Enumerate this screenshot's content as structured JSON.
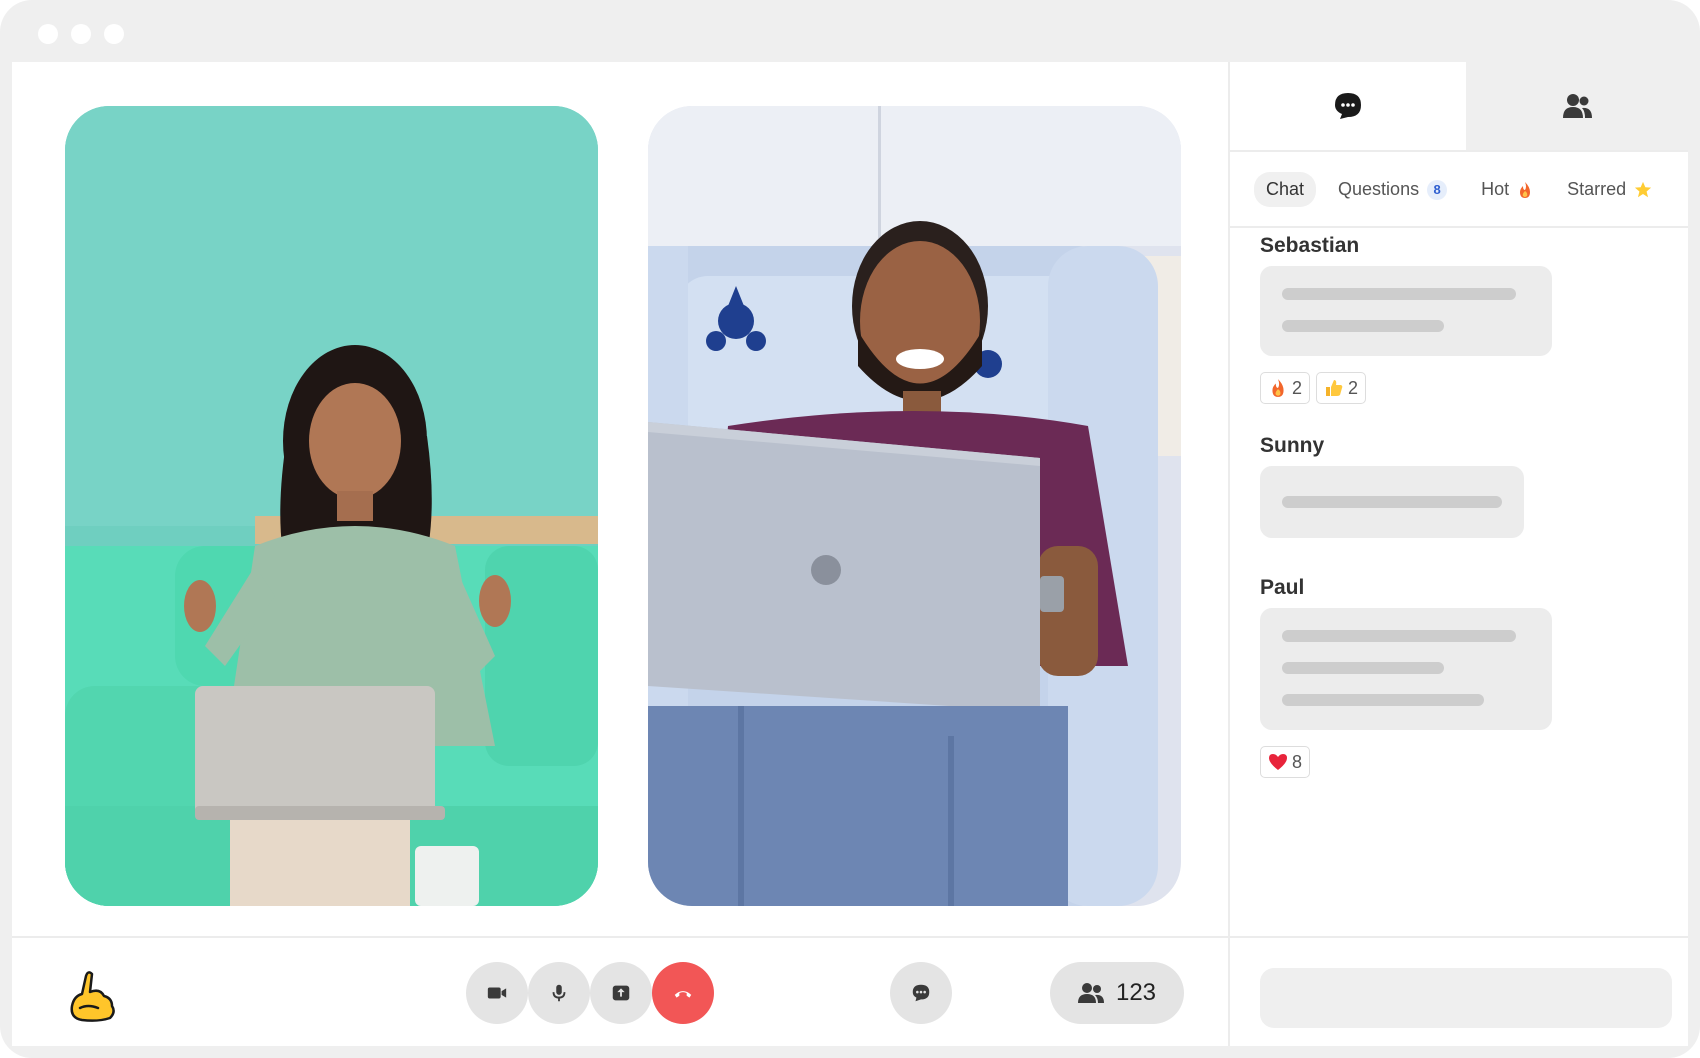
{
  "colors": {
    "window_bg": "#efefef",
    "end_call": "#f25656",
    "control_bg": "#e4e4e4",
    "bubble_bg": "#ececec",
    "badge_text": "#2f5fd0"
  },
  "window": {
    "controls": [
      "dot",
      "dot",
      "dot"
    ]
  },
  "videos": [
    {
      "participant": "woman-with-laptop-on-teal-sofa"
    },
    {
      "participant": "man-with-laptop-in-armchair"
    }
  ],
  "toolbar": {
    "logo_icon": "hand-logo-icon",
    "buttons": [
      "camera-icon",
      "microphone-icon",
      "share-screen-icon",
      "end-call-icon",
      "chat-icon"
    ],
    "participants_count": "123"
  },
  "panel": {
    "top_tabs": [
      "chat-bubble-icon",
      "people-icon"
    ],
    "subtabs": {
      "chat": "Chat",
      "questions": "Questions",
      "questions_count": "8",
      "hot": "Hot",
      "hot_icon": "fire-icon",
      "starred": "Starred",
      "starred_icon": "star-icon"
    },
    "messages": [
      {
        "author": "Sebastian",
        "reactions": [
          {
            "icon": "fire-icon",
            "count": "2"
          },
          {
            "icon": "thumbs-up-icon",
            "count": "2"
          }
        ]
      },
      {
        "author": "Sunny",
        "reactions": []
      },
      {
        "author": "Paul",
        "reactions": [
          {
            "icon": "heart-icon",
            "count": "8"
          }
        ]
      }
    ],
    "input_placeholder": ""
  }
}
